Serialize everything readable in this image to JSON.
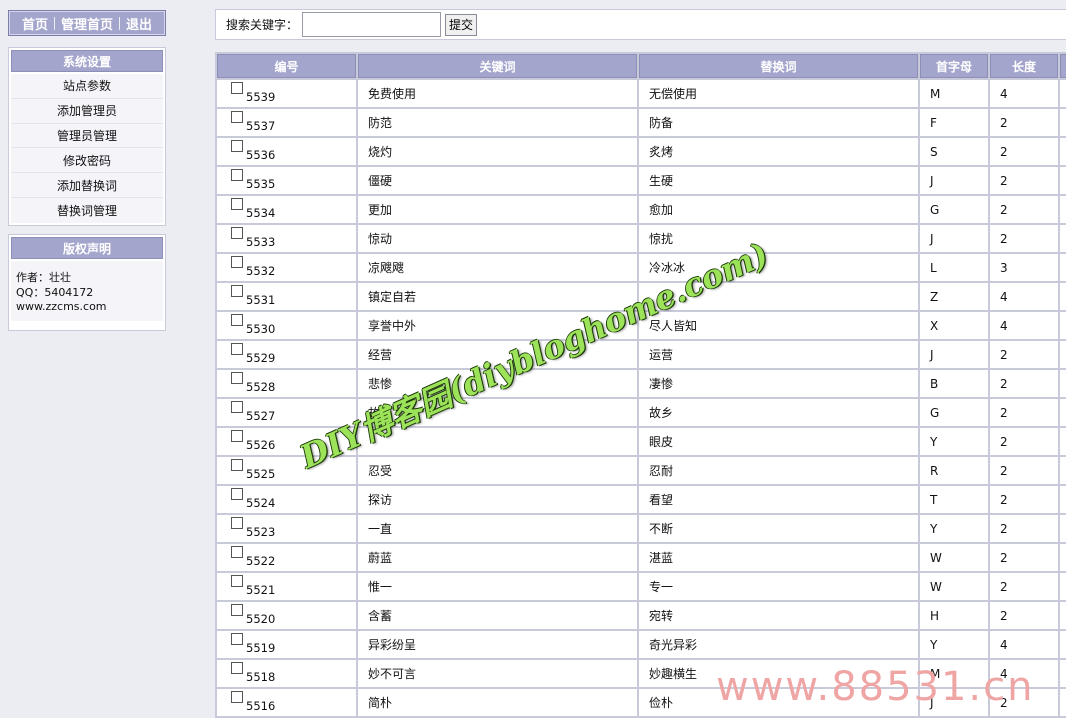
{
  "nav": {
    "home": "首页",
    "admin_home": "管理首页",
    "logout": "退出"
  },
  "settings": {
    "title": "系统设置",
    "items": [
      "站点参数",
      "添加管理员",
      "管理员管理",
      "修改密码",
      "添加替换词",
      "替换词管理"
    ]
  },
  "copyright": {
    "title": "版权声明",
    "author": "作者：壮壮",
    "qq": "QQ：5404172",
    "site": "www.zzcms.com"
  },
  "search": {
    "label": "搜索关键字：",
    "value": "",
    "submit": "提交"
  },
  "table": {
    "headers": [
      "编号",
      "关键词",
      "替换词",
      "首字母",
      "长度"
    ],
    "rows": [
      [
        "5539",
        "免费使用",
        "无偿使用",
        "M",
        "4"
      ],
      [
        "5537",
        "防范",
        "防备",
        "F",
        "2"
      ],
      [
        "5536",
        "烧灼",
        "炙烤",
        "S",
        "2"
      ],
      [
        "5535",
        "僵硬",
        "生硬",
        "J",
        "2"
      ],
      [
        "5534",
        "更加",
        "愈加",
        "G",
        "2"
      ],
      [
        "5533",
        "惊动",
        "惊扰",
        "J",
        "2"
      ],
      [
        "5532",
        "凉飕飕",
        "冷冰冰",
        "L",
        "3"
      ],
      [
        "5531",
        "镇定自若",
        "",
        "Z",
        "4"
      ],
      [
        "5530",
        "享誉中外",
        "尽人皆知",
        "X",
        "4"
      ],
      [
        "5529",
        "经营",
        "运营",
        "J",
        "2"
      ],
      [
        "5528",
        "悲惨",
        "凄惨",
        "B",
        "2"
      ],
      [
        "5527",
        "故土",
        "故乡",
        "G",
        "2"
      ],
      [
        "5526",
        "",
        "眼皮",
        "Y",
        "2"
      ],
      [
        "5525",
        "忍受",
        "忍耐",
        "R",
        "2"
      ],
      [
        "5524",
        "探访",
        "看望",
        "T",
        "2"
      ],
      [
        "5523",
        "一直",
        "不断",
        "Y",
        "2"
      ],
      [
        "5522",
        "蔚蓝",
        "湛蓝",
        "W",
        "2"
      ],
      [
        "5521",
        "惟一",
        "专一",
        "W",
        "2"
      ],
      [
        "5520",
        "含蓄",
        "宛转",
        "H",
        "2"
      ],
      [
        "5519",
        "异彩纷呈",
        "奇光异彩",
        "Y",
        "4"
      ],
      [
        "5518",
        "妙不可言",
        "妙趣横生",
        "M",
        "4"
      ],
      [
        "5516",
        "简朴",
        "俭朴",
        "J",
        "2"
      ]
    ]
  },
  "watermarks": {
    "diy": "DIY博客园(diybloghome.com)",
    "site": "www.88531.cn"
  }
}
